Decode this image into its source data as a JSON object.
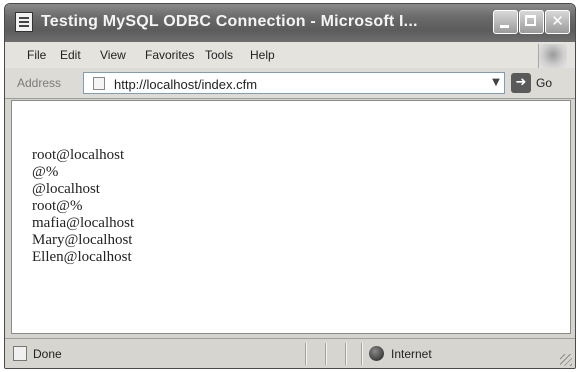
{
  "window": {
    "title": "Testing MySQL ODBC Connection - Microsoft I...",
    "controls": {
      "minimize_icon": "minimize-icon",
      "maximize_icon": "maximize-icon",
      "close_label": "✕"
    }
  },
  "menubar": {
    "items": [
      {
        "label": "File"
      },
      {
        "label": "Edit"
      },
      {
        "label": "View"
      },
      {
        "label": "Favorites"
      },
      {
        "label": "Tools"
      },
      {
        "label": "Help"
      }
    ]
  },
  "addressbar": {
    "label": "Address",
    "url": "http://localhost/index.cfm",
    "dropdown_glyph": "▼",
    "go_label": "Go",
    "go_glyph": "➜"
  },
  "content": {
    "users": [
      "root@localhost",
      "@%",
      "@localhost",
      "root@%",
      "mafia@localhost",
      "Mary@localhost",
      "Ellen@localhost"
    ]
  },
  "statusbar": {
    "status": "Done",
    "zone": "Internet"
  },
  "colors": {
    "titlebar": "#6a6a6a",
    "chrome": "#d4d3ce",
    "content_bg": "#ffffff"
  }
}
